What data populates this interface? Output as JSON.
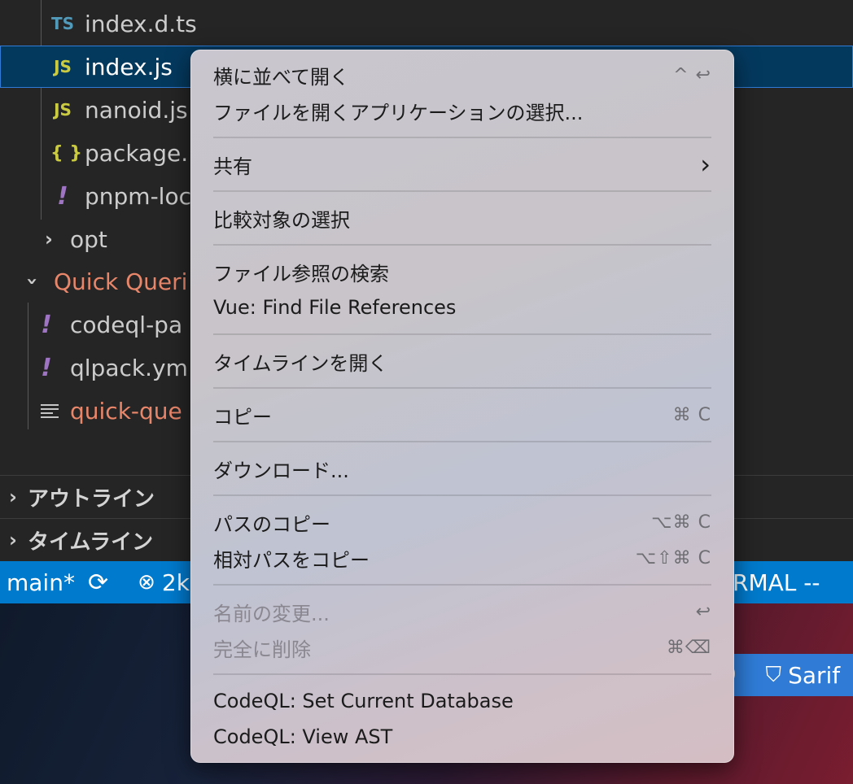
{
  "explorer": {
    "files": [
      {
        "icon": "TS",
        "label": "index.d.ts"
      },
      {
        "icon": "JS",
        "label": "index.js"
      },
      {
        "icon": "JS",
        "label": "nanoid.js"
      },
      {
        "icon": "{ }",
        "label": "package."
      },
      {
        "icon": "!",
        "label": "pnpm-loc"
      }
    ],
    "opt_folder": "opt",
    "quick_folder": "Quick Queri",
    "quick_files": [
      {
        "icon": "!",
        "label": "codeql-pa"
      },
      {
        "icon": "!",
        "label": "qlpack.ym"
      },
      {
        "label": "quick-que"
      }
    ],
    "sections": [
      "アウトライン",
      "タイムライン"
    ]
  },
  "statusbar": {
    "branch": "main*",
    "errors": "2k",
    "mode": "RMAL --"
  },
  "desktop": {
    "sarif_label": "Sarif",
    "clipped_char": "0"
  },
  "menu": {
    "items": [
      {
        "label": "横に並べて開く",
        "shortcut": "^ ↩"
      },
      {
        "label": "ファイルを開くアプリケーションの選択...",
        "shortcut": ""
      },
      {
        "label": "共有",
        "shortcut": "›"
      },
      {
        "label": "比較対象の選択",
        "shortcut": ""
      },
      {
        "label": "ファイル参照の検索",
        "shortcut": ""
      },
      {
        "label": "Vue: Find File References",
        "shortcut": ""
      },
      {
        "label": "タイムラインを開く",
        "shortcut": ""
      },
      {
        "label": "コピー",
        "shortcut": "⌘ C"
      },
      {
        "label": "ダウンロード...",
        "shortcut": ""
      },
      {
        "label": "パスのコピー",
        "shortcut": "⌥⌘ C"
      },
      {
        "label": "相対パスをコピー",
        "shortcut": "⌥⇧⌘ C"
      },
      {
        "label": "名前の変更...",
        "shortcut": "↩",
        "disabled": true
      },
      {
        "label": "完全に削除",
        "shortcut": "⌘⌫",
        "disabled": true
      },
      {
        "label": "CodeQL: Set Current Database",
        "shortcut": ""
      },
      {
        "label": "CodeQL: View AST",
        "shortcut": ""
      }
    ]
  }
}
